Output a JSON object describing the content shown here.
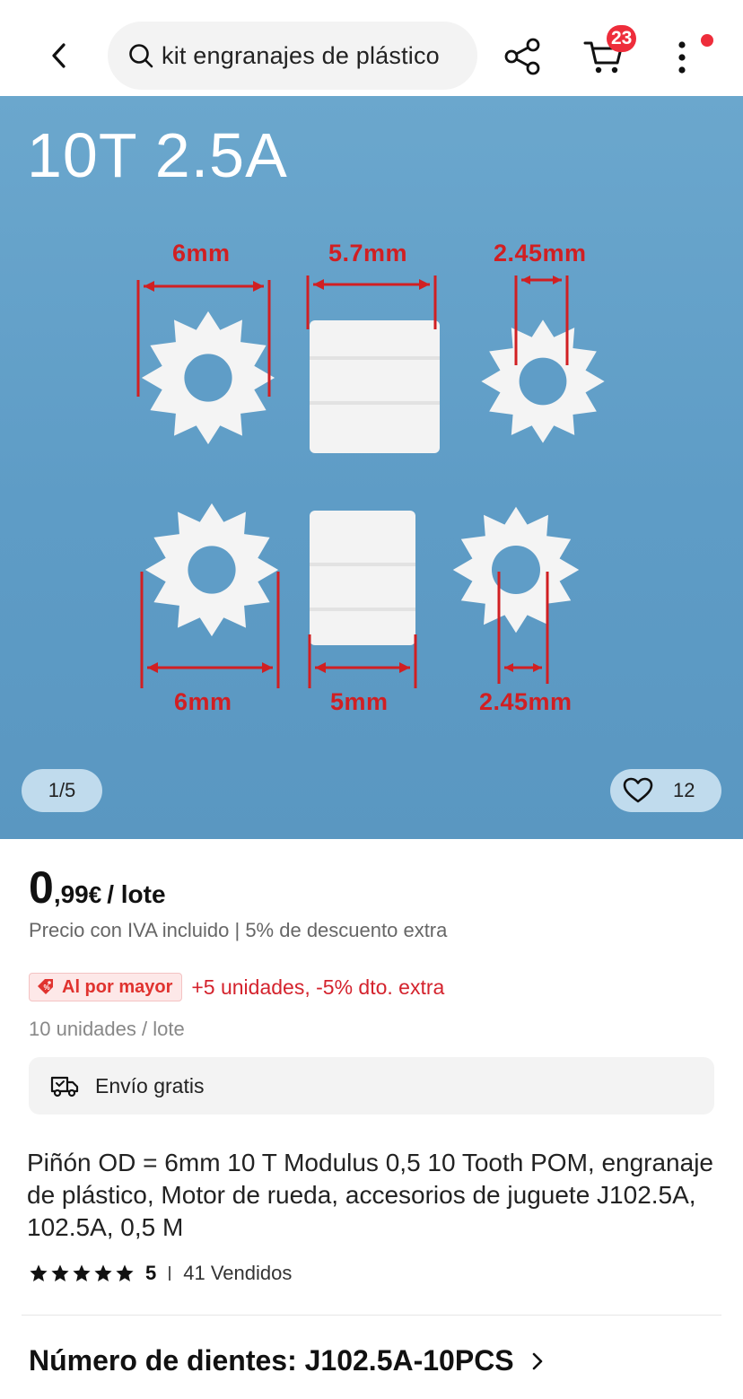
{
  "header": {
    "search_text": "kit engranajes de plástico",
    "cart_count": "23"
  },
  "gallery": {
    "image_title": "10T 2.5A",
    "dims": {
      "top_left": "6mm",
      "top_mid": "5.7mm",
      "top_right": "2.45mm",
      "bottom_left": "6mm",
      "bottom_mid": "5mm",
      "bottom_right": "2.45mm"
    },
    "counter": "1/5",
    "wishlist_count": "12"
  },
  "price": {
    "integer": "0",
    "decimal": ",99",
    "currency": "€",
    "unit": "/ lote",
    "vat_note": "Precio con IVA incluido | 5% de descuento extra"
  },
  "bulk": {
    "tag_label": "Al por mayor",
    "offer": "+5 unidades, -5% dto. extra",
    "lot_size": "10 unidades / lote"
  },
  "shipping": {
    "label": "Envío gratis"
  },
  "product": {
    "title": "Piñón OD = 6mm 10 T Modulus 0,5 10 Tooth POM, engranaje de plástico, Motor de rueda, accesorios de juguete J102.5A, 102.5A, 0,5 M",
    "rating": "5",
    "sold": "41 Vendidos"
  },
  "variant": {
    "label": "Número de dientes: J102.5A-10PCS"
  },
  "colors": {
    "accent_red": "#ee2d3b",
    "image_bg": "#5f9dc7"
  }
}
